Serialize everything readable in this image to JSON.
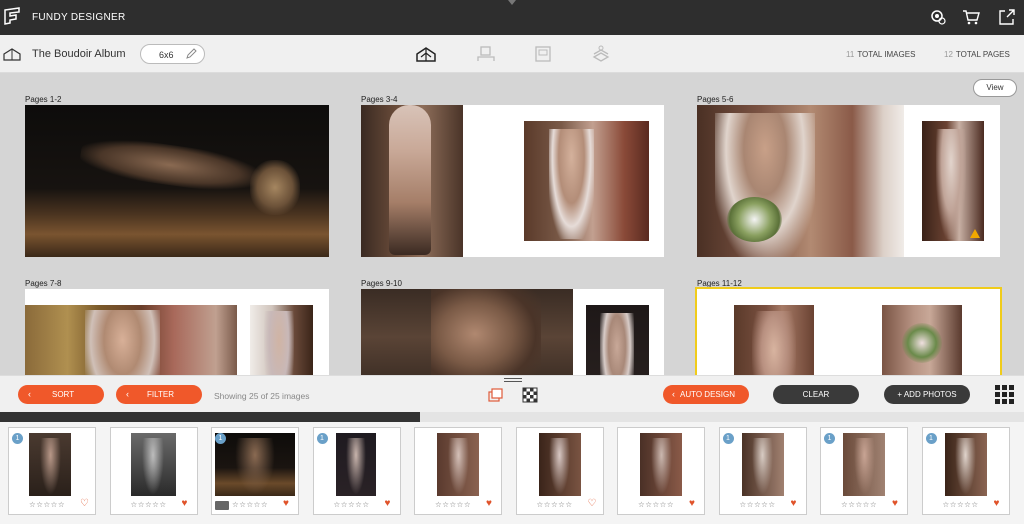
{
  "app": {
    "brand": "FUNDY DESIGNER",
    "top_icons": [
      "settings-gear-icon",
      "cart-icon",
      "external-link-icon"
    ]
  },
  "toolbar": {
    "album_name": "The Boudoir Album",
    "size": "6x6",
    "view_icons": [
      "album-view-icon",
      "layout-view-icon",
      "single-page-icon",
      "stack-view-icon"
    ],
    "total_images_count": "11",
    "total_images_label": "TOTAL IMAGES",
    "total_pages_count": "12",
    "total_pages_label": "TOTAL PAGES"
  },
  "workspace": {
    "view_button": "View",
    "spreads": [
      {
        "label": "Pages 1-2",
        "selected": false,
        "warning": false
      },
      {
        "label": "Pages 3-4",
        "selected": false,
        "warning": false
      },
      {
        "label": "Pages 5-6",
        "selected": false,
        "warning": true
      },
      {
        "label": "Pages 7-8",
        "selected": false,
        "warning": false
      },
      {
        "label": "Pages 9-10",
        "selected": false,
        "warning": false
      },
      {
        "label": "Pages 11-12",
        "selected": true,
        "warning": false
      }
    ]
  },
  "bottombar": {
    "sort": "SORT",
    "filter": "FILTER",
    "showing": "Showing 25 of 25 images",
    "auto_design": "AUTO DESIGN",
    "clear": "CLEAR",
    "add_photos": "+ ADD PHOTOS",
    "accent": "#f0582a"
  },
  "strip": {
    "scroll_progress": 0.41,
    "thumbnails": [
      {
        "badge": "1",
        "heart": "outline",
        "book": false
      },
      {
        "badge": "",
        "heart": "filled",
        "book": false
      },
      {
        "badge": "1",
        "heart": "filled",
        "book": true
      },
      {
        "badge": "1",
        "heart": "filled",
        "book": false
      },
      {
        "badge": "",
        "heart": "filled",
        "book": false
      },
      {
        "badge": "",
        "heart": "outline",
        "book": false
      },
      {
        "badge": "",
        "heart": "filled",
        "book": false
      },
      {
        "badge": "1",
        "heart": "filled",
        "book": false
      },
      {
        "badge": "1",
        "heart": "filled",
        "book": false
      },
      {
        "badge": "1",
        "heart": "filled",
        "book": false
      }
    ],
    "stars": "☆☆☆☆☆"
  }
}
